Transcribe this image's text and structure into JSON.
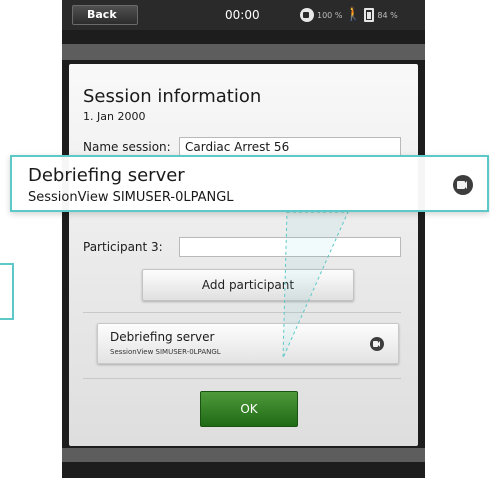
{
  "topbar": {
    "back_label": "Back",
    "clock": "00:00",
    "volume": "100 %",
    "battery": "84 %"
  },
  "dialog": {
    "title": "Session information",
    "date": "1. Jan 2000",
    "name_label": "Name session:",
    "name_value": "Cardiac Arrest 56",
    "participant3_label": "Participant 3:",
    "participant3_value": "",
    "add_participant_label": "Add participant",
    "debrief_title": "Debriefing server",
    "debrief_subtitle": "SessionView SIMUSER-0LPANGL",
    "ok_label": "OK"
  },
  "callout": {
    "title": "Debriefing server",
    "subtitle": "SessionView SIMUSER-0LPANGL"
  },
  "colors": {
    "accent_callout": "#5cc8c8",
    "ok_green": "#2e7d22",
    "device_bg": "#1d1d1d"
  },
  "icons": [
    "camera-icon",
    "person-icon",
    "battery-icon"
  ]
}
